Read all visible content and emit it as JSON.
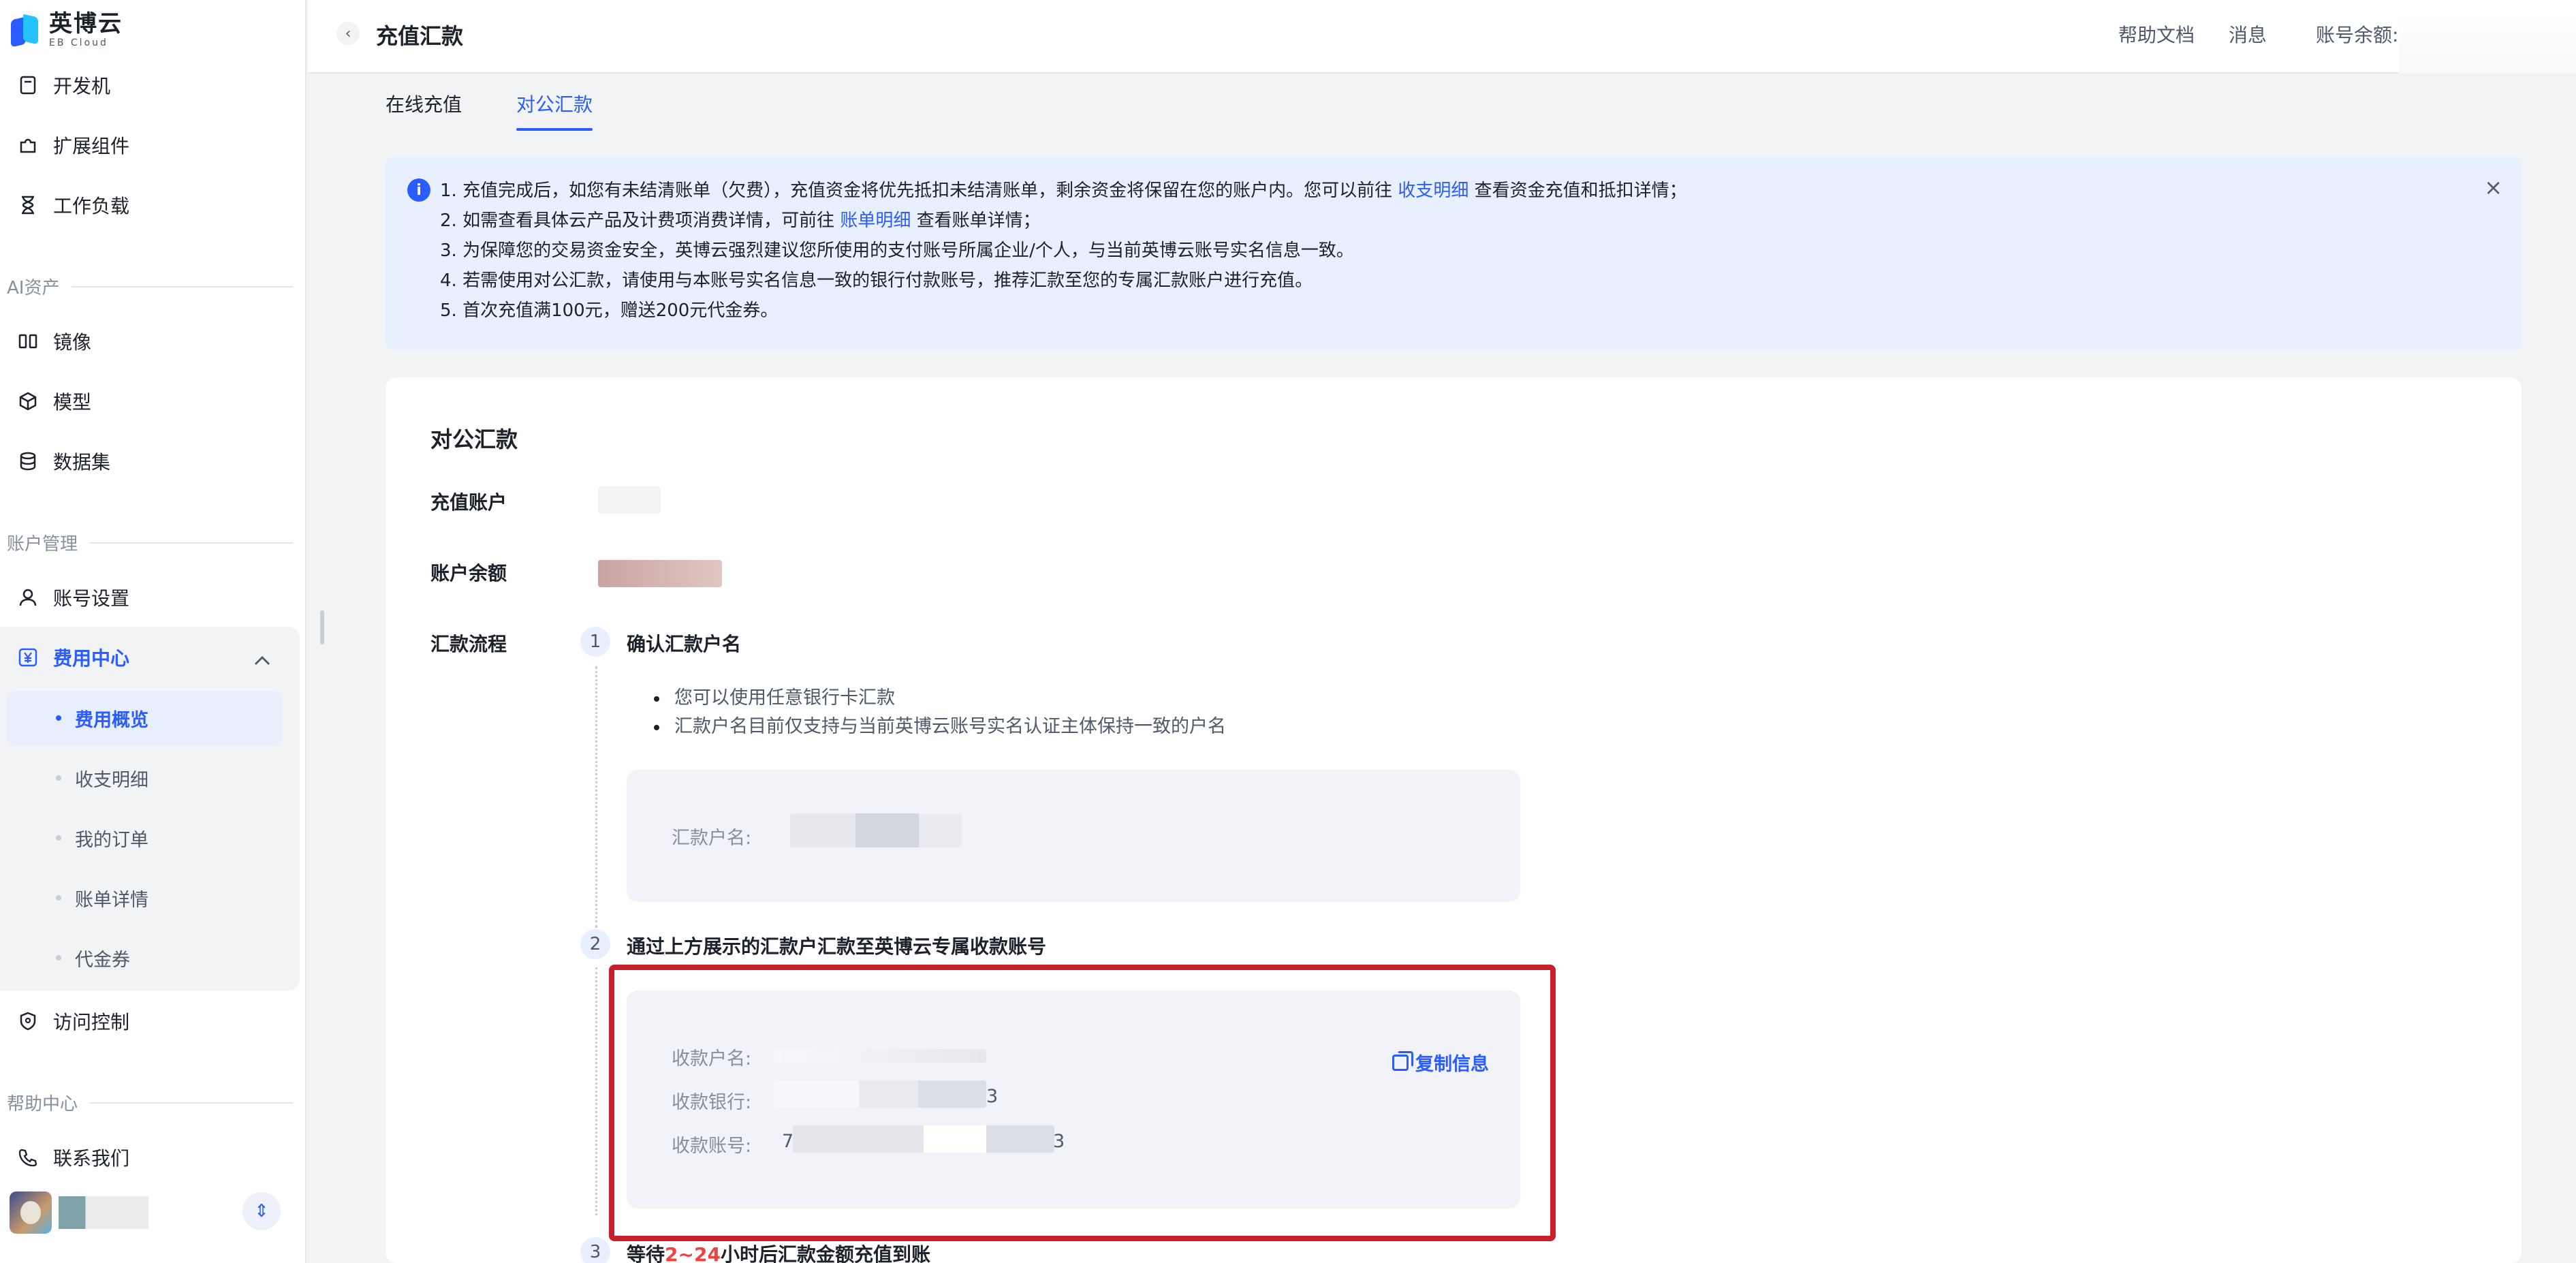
{
  "app": {
    "logo_name": "英博云",
    "logo_sub": "EB Cloud"
  },
  "sidebar": {
    "top_items": [
      {
        "label": "开发机",
        "icon": "notebook-icon"
      },
      {
        "label": "扩展组件",
        "icon": "puzzle-icon"
      },
      {
        "label": "工作负载",
        "icon": "hourglass-icon"
      }
    ],
    "sections": {
      "ai_assets": "AI资产",
      "account_mgmt": "账户管理",
      "help_center": "帮助中心"
    },
    "ai_items": [
      {
        "label": "镜像",
        "icon": "mirror-icon"
      },
      {
        "label": "模型",
        "icon": "cube-icon"
      },
      {
        "label": "数据集",
        "icon": "database-icon"
      }
    ],
    "account_items": [
      {
        "label": "账号设置",
        "icon": "user-icon"
      }
    ],
    "billing": {
      "label": "费用中心",
      "children": [
        "费用概览",
        "收支明细",
        "我的订单",
        "账单详情",
        "代金券"
      ],
      "active_child": "费用概览"
    },
    "access_control": "访问控制",
    "contact_us": "联系我们"
  },
  "header": {
    "title": "充值汇款",
    "links": [
      "帮助文档",
      "消息"
    ],
    "balance_label": "账号余额:"
  },
  "tabs": [
    {
      "label": "在线充值",
      "active": false
    },
    {
      "label": "对公汇款",
      "active": true
    }
  ],
  "notice": {
    "line1_pre": "1. 充值完成后，如您有未结清账单（欠费），充值资金将优先抵扣未结清账单，剩余资金将保留在您的账户内。您可以前往 ",
    "line1_link": "收支明细",
    "line1_post": " 查看资金充值和抵扣详情；",
    "line2_pre": "2. 如需查看具体云产品及计费项消费详情，可前往 ",
    "line2_link": "账单明细",
    "line2_post": " 查看账单详情；",
    "line3": "3. 为保障您的交易资金安全，英博云强烈建议您所使用的支付账号所属企业/个人，与当前英博云账号实名信息一致。",
    "line4": "4. 若需使用对公汇款，请使用与本账号实名信息一致的银行付款账号，推荐汇款至您的专属汇款账户进行充值。",
    "line5": "5. 首次充值满100元，赠送200元代金券。"
  },
  "transfer": {
    "title": "对公汇款",
    "recharge_account_label": "充值账户",
    "balance_label": "账户余额",
    "flow_label": "汇款流程",
    "step1": {
      "num": "1",
      "title": "确认汇款户名",
      "bullets": [
        "您可以使用任意银行卡汇款",
        "汇款户名目前仅支持与当前英博云账号实名认证主体保持一致的户名"
      ],
      "remitter_label": "汇款户名:"
    },
    "step2": {
      "num": "2",
      "title": "通过上方展示的汇款户汇款至英博云专属收款账号",
      "payee_name_label": "收款户名:",
      "bank_label": "收款银行:",
      "account_label": "收款账号:",
      "bank_tail": "3",
      "account_head": "7",
      "account_tail": "3",
      "copy_label": "复制信息"
    },
    "step3": {
      "num": "3",
      "title_pre": "等待",
      "title_highlight": "2~24",
      "title_post": "小时后汇款金额充值到账"
    }
  }
}
